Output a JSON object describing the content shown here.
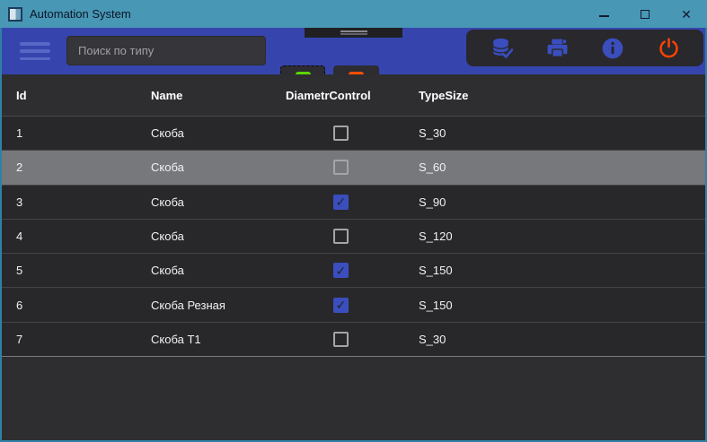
{
  "window": {
    "title": "Automation System",
    "control_icons": [
      "minimize-icon",
      "maximize-icon",
      "close-icon"
    ]
  },
  "toolbar": {
    "menu_icon": "hamburger-icon",
    "search": {
      "placeholder": "Поиск по типу",
      "value": ""
    },
    "add_icon": "plus-icon",
    "remove_icon": "minus-icon",
    "action_icons": [
      "database-check-icon",
      "printer-icon",
      "info-icon",
      "power-icon"
    ]
  },
  "table": {
    "columns": [
      "Id",
      "Name",
      "DiametrControl",
      "TypeSize"
    ],
    "rows": [
      {
        "id": "1",
        "name": "Скоба",
        "diametr_control": false,
        "type_size": "S_30",
        "selected": false
      },
      {
        "id": "2",
        "name": "Скоба",
        "diametr_control": false,
        "type_size": "S_60",
        "selected": true
      },
      {
        "id": "3",
        "name": "Скоба",
        "diametr_control": true,
        "type_size": "S_90",
        "selected": false
      },
      {
        "id": "4",
        "name": "Скоба",
        "diametr_control": false,
        "type_size": "S_120",
        "selected": false
      },
      {
        "id": "5",
        "name": "Скоба",
        "diametr_control": true,
        "type_size": "S_150",
        "selected": false
      },
      {
        "id": "6",
        "name": "Скоба Резная",
        "diametr_control": true,
        "type_size": "S_150",
        "selected": false
      },
      {
        "id": "7",
        "name": "Скоба Т1",
        "diametr_control": false,
        "type_size": "S_30",
        "selected": false
      }
    ]
  },
  "colors": {
    "titlebar": "#4797B5",
    "toolbar": "#3645AE",
    "window_border": "#2E81A4",
    "add_green": "#5CD600",
    "remove_orange": "#FF4E00",
    "icon_indigo": "#3B4EBE",
    "power_red": "#FF4300",
    "selected_row": "#76787B",
    "checkbox_checked": "#3B4EBE",
    "row_bg": "#28282B",
    "header_bg": "#2E2E31"
  }
}
